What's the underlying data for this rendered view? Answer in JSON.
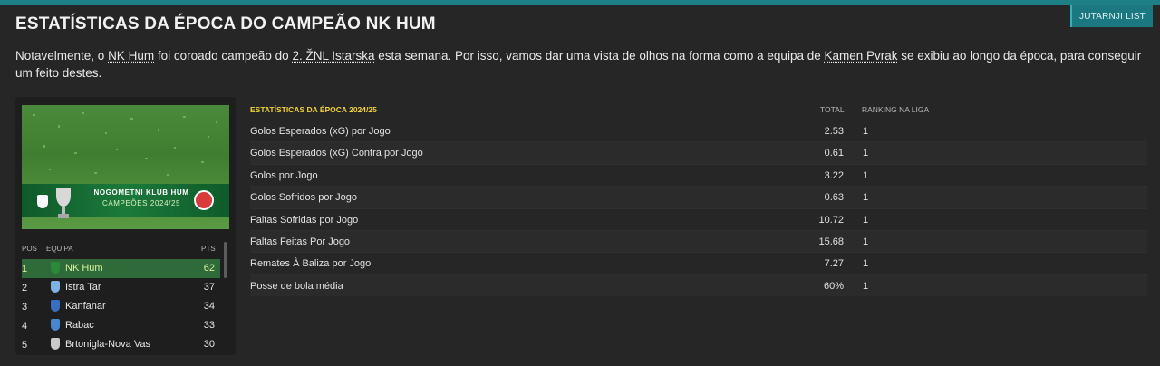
{
  "header": {
    "title": "ESTATÍSTICAS DA ÉPOCA DO CAMPEÃO NK HUM",
    "corner_tag": "JUTARNJI LIST"
  },
  "intro": {
    "p1": "Notavelmente, o ",
    "club": "NK Hum",
    "p2": " foi coroado campeão do ",
    "league": "2. ŽNL Istarska",
    "p3": " esta semana. Por isso, vamos dar uma vista de olhos na forma como a equipa de ",
    "manager": "Kamen Pvrak",
    "p4": " se exibiu ao longo da época, para conseguir um feito destes."
  },
  "banner": {
    "club_name": "NOGOMETNI KLUB HUM",
    "champions": "CAMPEÕES 2024/25"
  },
  "league_table": {
    "headers": {
      "pos": "POS",
      "team": "EQUIPA",
      "pts": "PTS"
    },
    "rows": [
      {
        "pos": "1",
        "team": "NK Hum",
        "pts": "62",
        "crest_color": "#2a8a3a"
      },
      {
        "pos": "2",
        "team": "Istra Tar",
        "pts": "37",
        "crest_color": "#7fb3e6"
      },
      {
        "pos": "3",
        "team": "Kanfanar",
        "pts": "34",
        "crest_color": "#3a6fc0"
      },
      {
        "pos": "4",
        "team": "Rabac",
        "pts": "33",
        "crest_color": "#4a86d0"
      },
      {
        "pos": "5",
        "team": "Brtonigla-Nova Vas",
        "pts": "30",
        "crest_color": "#c9c9c9"
      }
    ]
  },
  "stats": {
    "title": "ESTATÍSTICAS DA ÉPOCA 2024/25",
    "col_total": "TOTAL",
    "col_rank": "RANKING NA LIGA",
    "rows": [
      {
        "label": "Golos Esperados (xG) por Jogo",
        "total": "2.53",
        "rank": "1"
      },
      {
        "label": "Golos Esperados (xG) Contra por Jogo",
        "total": "0.61",
        "rank": "1"
      },
      {
        "label": "Golos por Jogo",
        "total": "3.22",
        "rank": "1"
      },
      {
        "label": "Golos Sofridos por Jogo",
        "total": "0.63",
        "rank": "1"
      },
      {
        "label": "Faltas Sofridas por Jogo",
        "total": "10.72",
        "rank": "1"
      },
      {
        "label": "Faltas Feitas Por Jogo",
        "total": "15.68",
        "rank": "1"
      },
      {
        "label": "Remates À Baliza por Jogo",
        "total": "7.27",
        "rank": "1"
      },
      {
        "label": "Posse de bola média",
        "total": "60%",
        "rank": "1"
      }
    ]
  },
  "colors": {
    "accent": "#1f7f86",
    "highlight_row": "#2e6a3a",
    "stats_title": "#f0d23a"
  }
}
